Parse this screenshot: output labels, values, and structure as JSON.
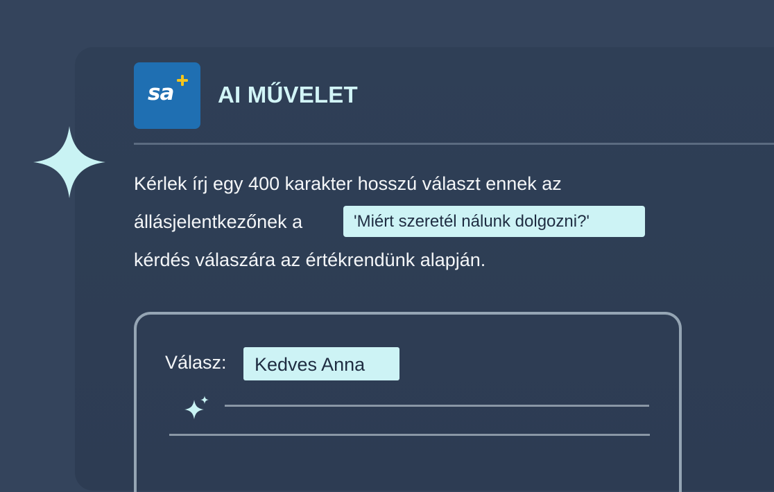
{
  "header": {
    "logo_text": "sa",
    "title": "AI MŰVELET"
  },
  "prompt": {
    "line1": "Kérlek írj egy 400 karakter hosszú választ ennek az",
    "line2": "állásjelentkezőnek a",
    "question_chip": "'Miért szeretél nálunk dolgozni?'",
    "line3": "kérdés válaszára az értékrendünk alapján."
  },
  "response": {
    "label": "Válasz:",
    "value": "Kedves Anna"
  },
  "icons": {
    "big_sparkle": "sparkle-icon",
    "small_sparkle": "ai-sparkles-icon",
    "logo_plus": "plus-icon"
  },
  "colors": {
    "background": "#34445c",
    "card": "#2f3f56",
    "logo_blue": "#1f6fb2",
    "accent_cyan": "#cdf3f5",
    "logo_plus_yellow": "#f5c51b"
  }
}
